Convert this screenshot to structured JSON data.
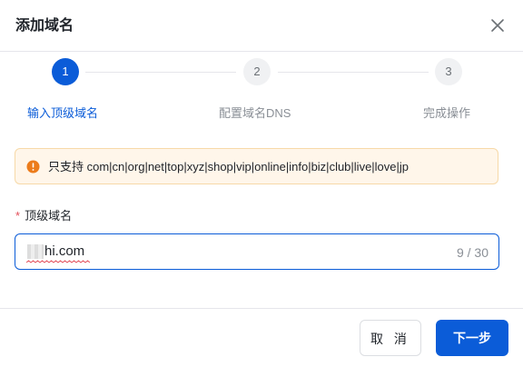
{
  "dialog": {
    "title": "添加域名",
    "close_icon": "close-icon"
  },
  "steps": [
    {
      "number": "1",
      "label": "输入顶级域名",
      "state": "active"
    },
    {
      "number": "2",
      "label": "配置域名DNS",
      "state": "pending"
    },
    {
      "number": "3",
      "label": "完成操作",
      "state": "pending"
    }
  ],
  "alert": {
    "icon": "warning-icon",
    "text": "只支持 com|cn|org|net|top|xyz|shop|vip|online|info|biz|club|live|love|jp"
  },
  "form": {
    "label": "顶级域名",
    "required_mark": "*",
    "value": "hi.com",
    "counter": "9 / 30"
  },
  "footer": {
    "cancel_label": "取 消",
    "next_label": "下一步"
  },
  "colors": {
    "primary": "#0b5cd8",
    "warning_bg": "#fff6ea",
    "warning_icon": "#ec7c1b",
    "required": "#e34d59"
  }
}
